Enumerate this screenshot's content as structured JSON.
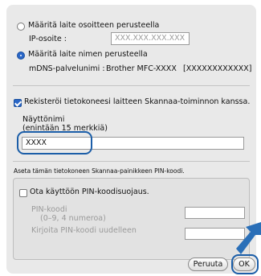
{
  "options": {
    "address": {
      "label": "Määritä laite osoitteen perusteella",
      "ip_label": "IP-osoite :",
      "ip_placeholder": "XXX.XXX.XXX.XXX"
    },
    "name": {
      "label": "Määritä laite nimen perusteella",
      "mdns_label": "mDNS-palvelunimi :",
      "mdns_value": "Brother MFC-XXXX",
      "mdns_id": "[XXXXXXXXXXXX]"
    }
  },
  "register": {
    "label": "Rekisteröi tietokoneesi laitteen Skannaa-toiminnon kanssa.",
    "display_name_label": "Näyttönimi",
    "display_name_hint": "(enintään 15 merkkiä)",
    "display_name_value": "XXXX"
  },
  "pin": {
    "section_title": "Aseta tämän tietokoneen Skannaa-painikkeen PIN-koodi.",
    "enable_label": "Ota käyttöön PIN-koodisuojaus.",
    "pin_label": "PIN-koodi",
    "pin_hint": "(0–9, 4 numeroa)",
    "repeat_label": "Kirjoita PIN-koodi uudelleen"
  },
  "buttons": {
    "cancel": "Peruuta",
    "ok": "OK"
  },
  "colors": {
    "accent": "#1c5ea8",
    "arrow": "#2a6fb8"
  }
}
